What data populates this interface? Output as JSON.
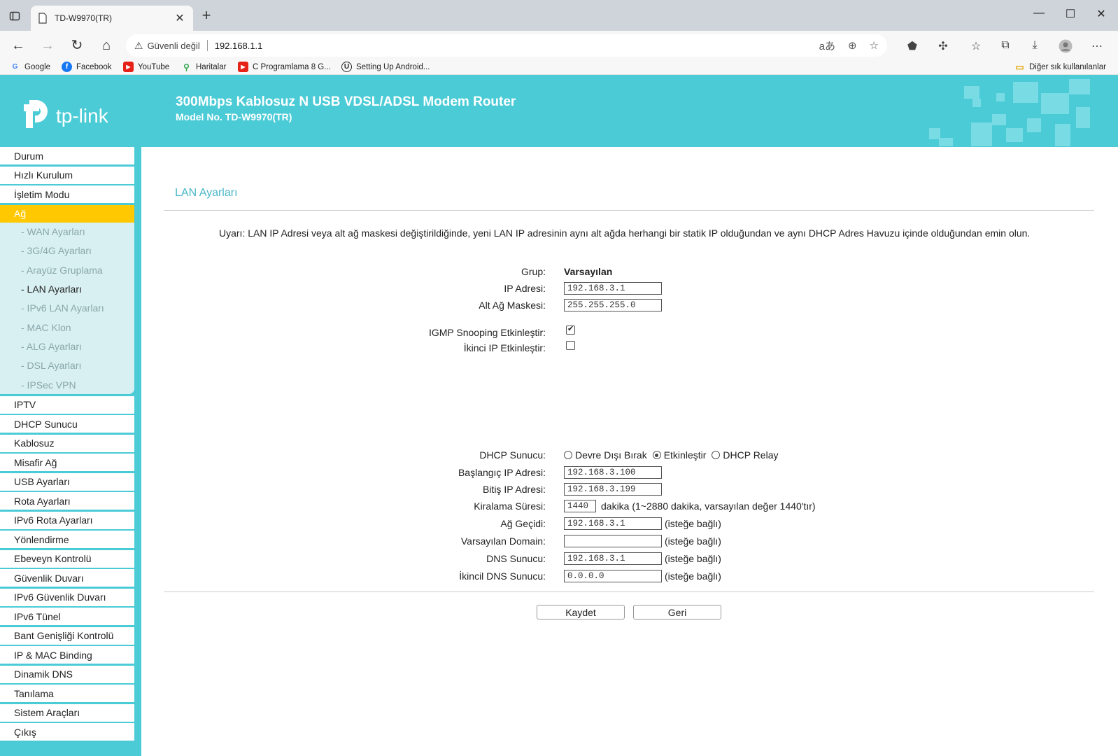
{
  "browser": {
    "tab_title": "TD-W9970(TR)",
    "security_label": "Güvenli değil",
    "url": "192.168.1.1",
    "bookmarks": [
      {
        "label": "Google",
        "icon": "google-icon"
      },
      {
        "label": "Facebook",
        "icon": "facebook-icon"
      },
      {
        "label": "YouTube",
        "icon": "youtube-icon"
      },
      {
        "label": "Haritalar",
        "icon": "maps-icon"
      },
      {
        "label": "C Programlama 8 G...",
        "icon": "youtube-icon"
      },
      {
        "label": "Setting Up Android...",
        "icon": "unreal-icon"
      }
    ],
    "other_bookmarks": "Diğer sık kullanılanlar"
  },
  "header": {
    "logo_text": "tp-link",
    "product_title": "300Mbps Kablosuz N USB VDSL/ADSL Modem Router",
    "model": "Model No. TD-W9970(TR)"
  },
  "sidebar": {
    "items_top": [
      "Durum",
      "Hızlı Kurulum",
      "İşletim Modu"
    ],
    "active_item": "Ağ",
    "subitems": [
      "- WAN Ayarları",
      "- 3G/4G Ayarları",
      "- Arayüz Gruplama",
      "- LAN Ayarları",
      "- IPv6 LAN Ayarları",
      "- MAC Klon",
      "- ALG Ayarları",
      "- DSL Ayarları",
      "- IPSec VPN"
    ],
    "active_subitem": "- LAN Ayarları",
    "items_bottom": [
      "IPTV",
      "DHCP Sunucu",
      "Kablosuz",
      "Misafir Ağ",
      "USB Ayarları",
      "Rota Ayarları",
      "IPv6 Rota Ayarları",
      "Yönlendirme",
      "Ebeveyn Kontrolü",
      "Güvenlik Duvarı",
      "IPv6 Güvenlik Duvarı",
      "IPv6 Tünel",
      "Bant Genişliği Kontrolü",
      "IP & MAC Binding",
      "Dinamik DNS",
      "Tanılama",
      "Sistem Araçları",
      "Çıkış"
    ]
  },
  "main": {
    "section_title": "LAN Ayarları",
    "warning": "Uyarı: LAN IP Adresi veya alt ağ maskesi değiştirildiğinde, yeni LAN IP adresinin aynı alt ağda herhangi bir statik IP olduğundan ve aynı DHCP Adres Havuzu içinde olduğundan emin olun.",
    "group_label": "Grup:",
    "group_value": "Varsayılan",
    "ip_label": "IP Adresi:",
    "ip_value": "192.168.3.1",
    "mask_label": "Alt Ağ Maskesi:",
    "mask_value": "255.255.255.0",
    "igmp_label": "IGMP Snooping Etkinleştir:",
    "igmp_checked": true,
    "second_ip_label": "İkinci IP Etkinleştir:",
    "second_ip_checked": false,
    "dhcp_label": "DHCP Sunucu:",
    "dhcp_options": [
      "Devre Dışı Bırak",
      "Etkinleştir",
      "DHCP Relay"
    ],
    "dhcp_selected": "Etkinleştir",
    "start_label": "Başlangıç IP Adresi:",
    "start_value": "192.168.3.100",
    "end_label": "Bitiş IP Adresi:",
    "end_value": "192.168.3.199",
    "lease_label": "Kiralama Süresi:",
    "lease_value": "1440",
    "lease_note": "dakika (1~2880 dakika, varsayılan değer 1440'tır)",
    "gateway_label": "Ağ Geçidi:",
    "gateway_value": "192.168.3.1",
    "domain_label": "Varsayılan Domain:",
    "domain_value": "",
    "dns_label": "DNS Sunucu:",
    "dns_value": "192.168.3.1",
    "dns2_label": "İkincil DNS Sunucu:",
    "dns2_value": "0.0.0.0",
    "optional_note": "(isteğe bağlı)",
    "save_button": "Kaydet",
    "back_button": "Geri"
  }
}
